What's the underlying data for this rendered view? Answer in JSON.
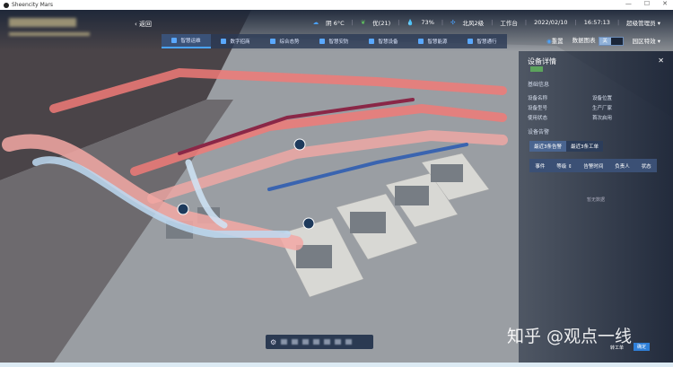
{
  "window": {
    "title": "Sheencity Mars",
    "controls": [
      "—",
      "☐",
      "✕"
    ]
  },
  "header": {
    "back_label": "返回",
    "status": {
      "weather": "阴 6°C",
      "air": "优(21)",
      "humidity": "73%",
      "wind": "北风2级",
      "workbench": "工作台",
      "date": "2022/02/10",
      "time": "16:57:13",
      "user": "超级管理员 ▾"
    }
  },
  "nav": {
    "items": [
      {
        "label": "智慧运维",
        "active": true
      },
      {
        "label": "数字招商"
      },
      {
        "label": "综合态势"
      },
      {
        "label": "智慧安防"
      },
      {
        "label": "智慧设备"
      },
      {
        "label": "智慧能源"
      },
      {
        "label": "智慧通行"
      }
    ]
  },
  "controls": {
    "reset": "重置",
    "data_chart": "数据图表",
    "toggle_on": "关",
    "effects": "园区特效 ▾"
  },
  "panel": {
    "title": "设备详情",
    "close": "✕",
    "basic_info": "基础信息",
    "fields": [
      {
        "label": "设备名称"
      },
      {
        "label": "设备位置"
      },
      {
        "label": "设备型号"
      },
      {
        "label": "生产厂家"
      },
      {
        "label": "使用状态"
      },
      {
        "label": "首次启用"
      }
    ],
    "alarm_section": "设备告警",
    "tabs": [
      "最近3条告警",
      "最近3条工单"
    ],
    "columns": [
      "事件",
      "等级 ⇕",
      "告警时间",
      "负责人",
      "状态"
    ],
    "empty": "暂无数据",
    "buttons": [
      "转工单",
      "确定"
    ]
  },
  "watermark": "知乎 @观点一线",
  "colors": {
    "accent": "#4aa3ff",
    "hot_pipe": "#f07a78",
    "cold_pipe": "#9fc6ea",
    "return_pipe": "#8a2747"
  }
}
